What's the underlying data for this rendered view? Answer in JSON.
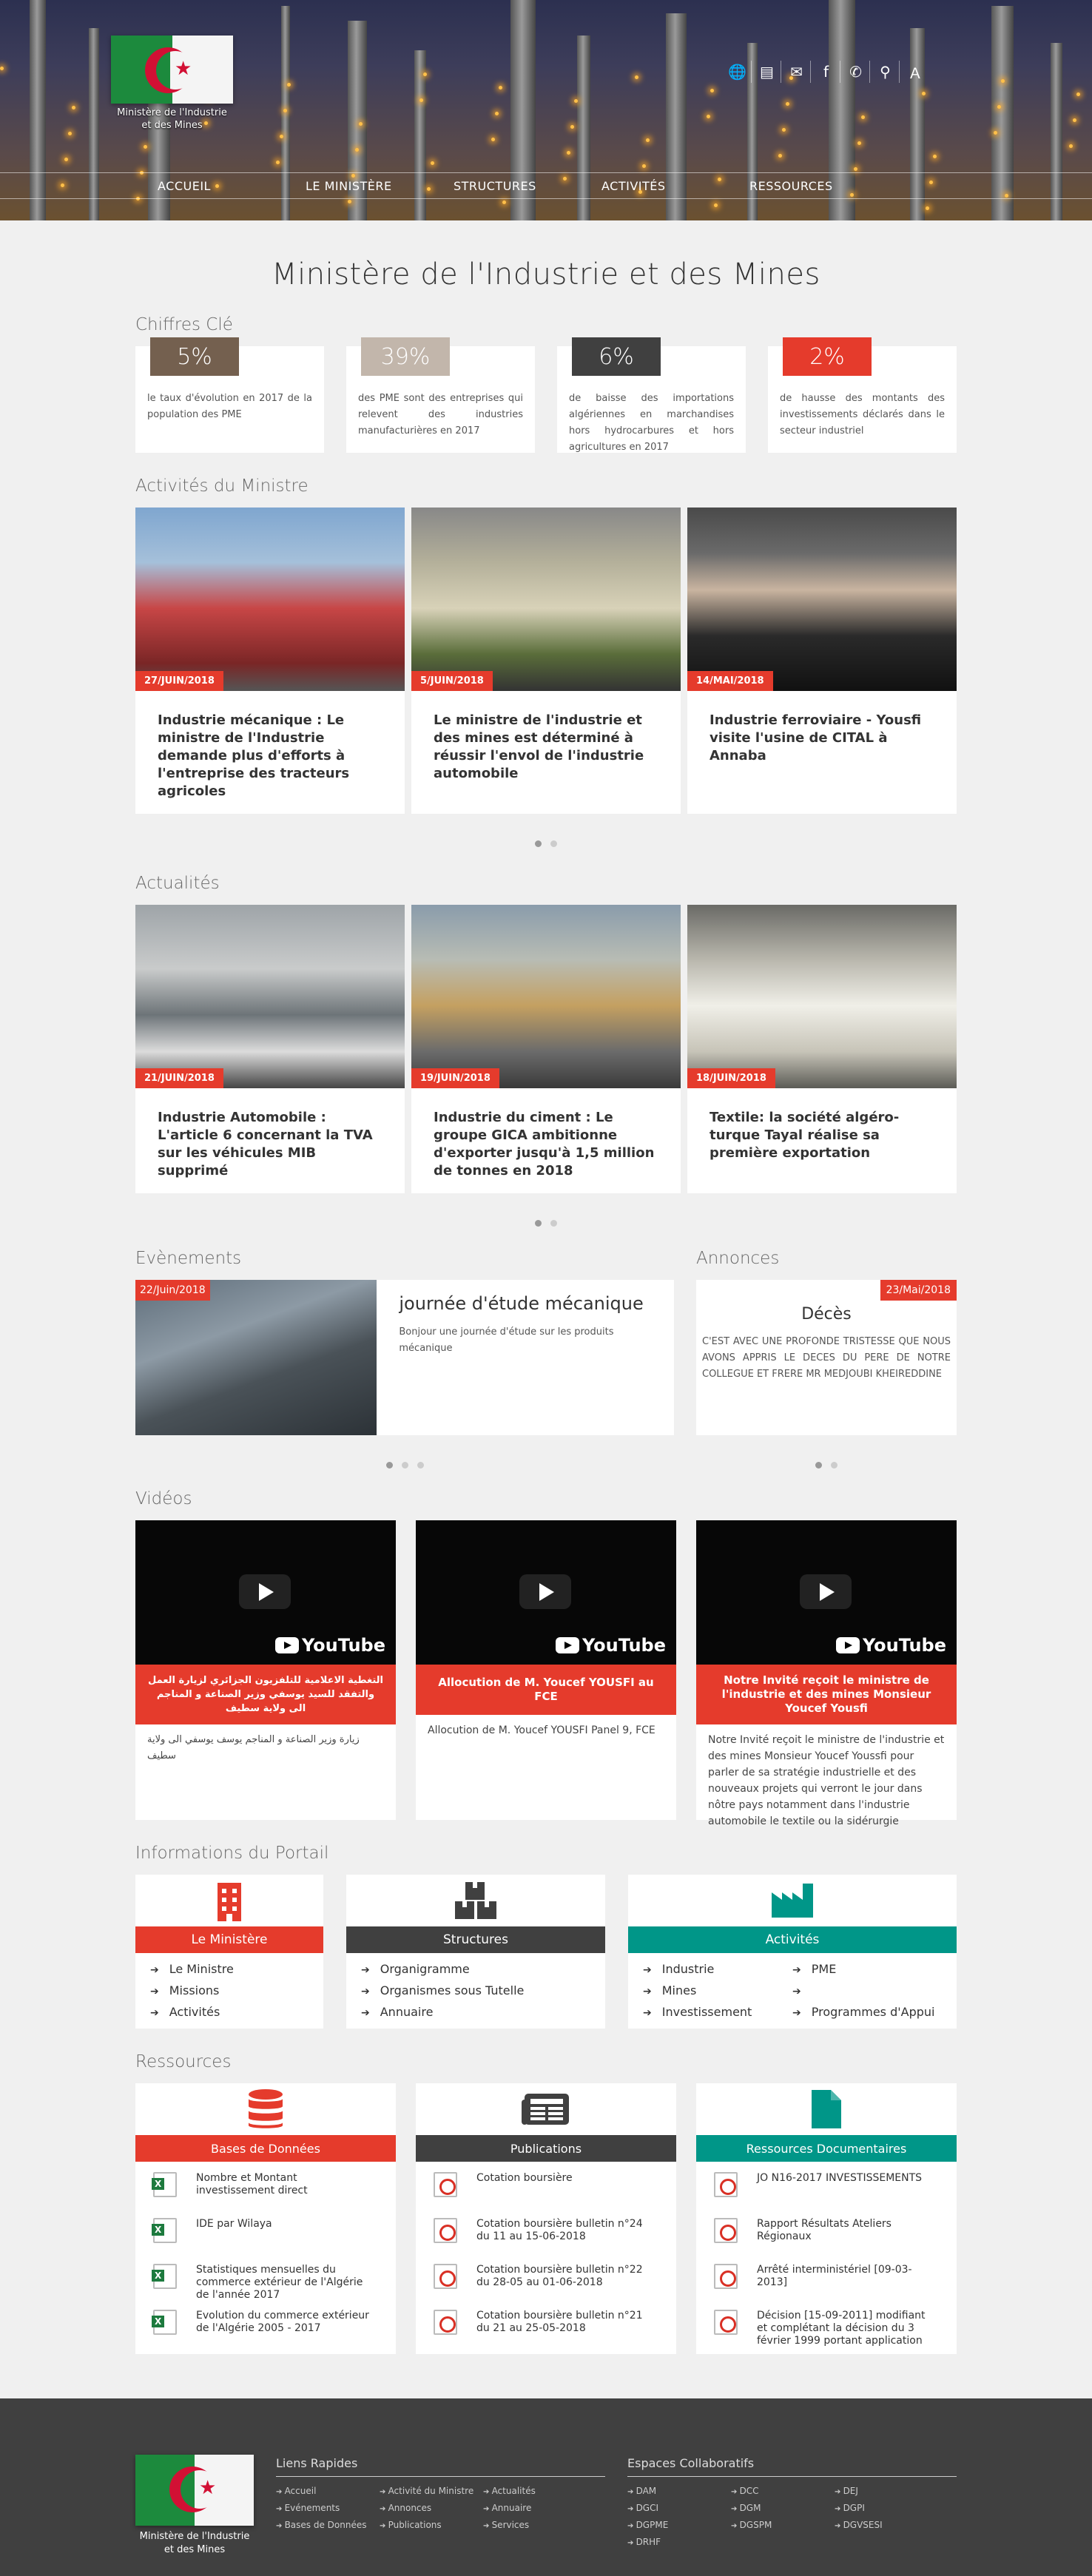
{
  "header": {
    "logo_text": "Ministère de l'Industrie et des Mines",
    "nav": [
      "ACCUEIL",
      "LE MINISTÈRE",
      "STRUCTURES",
      "ACTIVITÉS",
      "RESSOURCES"
    ]
  },
  "page_title": "Ministère de l'Industrie et des Mines",
  "chiffres": {
    "title": "Chiffres Clé",
    "items": [
      {
        "value": "5%",
        "text": "le taux d'évolution en 2017 de la population des PME",
        "color": "#74604f"
      },
      {
        "value": "39%",
        "text": "des PME sont des entreprises qui relevent des industries manufacturières en 2017",
        "color": "#c2b6ab"
      },
      {
        "value": "6%",
        "text": "de baisse des importations algériennes en marchandises hors hydrocarbures et hors agricultures en 2017",
        "color": "#404040"
      },
      {
        "value": "2%",
        "text": "de hausse des montants des investissements déclarés dans le secteur industriel",
        "color": "#e53b2c"
      }
    ]
  },
  "activites": {
    "title": "Activités du Ministre",
    "cards": [
      {
        "date": "27/JUIN/2018",
        "title": "Industrie mécanique : Le ministre de l'Industrie demande plus d'efforts à l'entreprise des tracteurs agricoles"
      },
      {
        "date": "5/JUIN/2018",
        "title": "Le ministre de l'industrie et des mines est déterminé à réussir l'envol de l'industrie automobile"
      },
      {
        "date": "14/MAI/2018",
        "title": "Industrie ferroviaire - Yousfi visite l'usine de CITAL à Annaba"
      }
    ]
  },
  "actualites": {
    "title": "Actualités",
    "cards": [
      {
        "date": "21/JUIN/2018",
        "title": "Industrie Automobile : L'article 6 concernant la TVA sur les véhicules MIB supprimé"
      },
      {
        "date": "19/JUIN/2018",
        "title": "Industrie du ciment : Le groupe GICA ambitionne d'exporter jusqu'à 1,5 million de tonnes en 2018"
      },
      {
        "date": "18/JUIN/2018",
        "title": "Textile: la société algéro-turque Tayal réalise sa première exportation"
      }
    ]
  },
  "evenements": {
    "title": "Evènements",
    "date": "22/Juin/2018",
    "heading": "journée d'étude mécanique",
    "text": "Bonjour une journée d'étude sur les produits mécanique"
  },
  "annonces": {
    "title": "Annonces",
    "date": "23/Mai/2018",
    "heading": "Décès",
    "text": "C'est avec une profonde tristesse que nous avons appris le deces du pere de notre collegue et frere Mr MEDJOUBI KHEIREDDINE"
  },
  "videos": {
    "title": "Vidéos",
    "brand": "YouTube",
    "items": [
      {
        "title": "التغطية الاعلامية للتلفزيون الجزائري لزيارة العمل والتفقد للسيد يوسفي وزير الصناعة و المناجم الى ولاية سطيف",
        "desc": "زيارة وزير الصناعة و المناجم يوسف يوسفي الى ولاية سطيف"
      },
      {
        "title": "Allocution de M. Youcef YOUSFI au FCE",
        "desc": "Allocution de M. Youcef YOUSFI Panel 9, FCE"
      },
      {
        "title": "Notre Invité reçoit le ministre de l'industrie et des mines Monsieur Youcef Yousfi",
        "desc": "Notre Invité reçoit le ministre de l'industrie et des mines Monsieur Youcef Youssfi pour parler de sa stratégie industrielle et des nouveaux projets qui verront le jour dans nôtre pays notamment dans l'industrie automobile le textile ou la sidérurgie"
      }
    ]
  },
  "informations": {
    "title": "Informations du Portail",
    "blocks": [
      {
        "label": "Le Ministère",
        "color": "#e53b2c",
        "icon_color": "#e53b2c",
        "links": [
          "Le Ministre",
          "Missions",
          "Activités"
        ]
      },
      {
        "label": "Structures",
        "color": "#404040",
        "icon_color": "#404040",
        "links": [
          "Organigramme",
          "Organismes sous Tutelle",
          "Annuaire"
        ]
      },
      {
        "label": "Activités",
        "color": "#009688",
        "icon_color": "#009688",
        "links": [
          "Industrie",
          "PME",
          "Mines",
          "",
          "Investissement",
          "Programmes d'Appui"
        ]
      }
    ]
  },
  "ressources": {
    "title": "Ressources",
    "blocks": [
      {
        "label": "Bases de Données",
        "color": "#e53b2c",
        "type": "xl",
        "items": [
          "Nombre et Montant investissement direct",
          "IDE par Wilaya",
          "Statistiques mensuelles du commerce extérieur de l'Algérie de l'année 2017",
          "Evolution du commerce extérieur de l'Algérie 2005 - 2017"
        ]
      },
      {
        "label": "Publications",
        "color": "#404040",
        "type": "pdf",
        "items": [
          "Cotation boursière",
          "Cotation boursière bulletin n°24 du 11 au 15-06-2018",
          "Cotation boursière bulletin n°22 du 28-05 au 01-06-2018",
          "Cotation boursière bulletin n°21 du 21 au 25-05-2018"
        ]
      },
      {
        "label": "Ressources Documentaires",
        "color": "#009688",
        "type": "pdf",
        "items": [
          "JO N16-2017 INVESTISSEMENTS",
          "Rapport Résultats Ateliers Régionaux",
          "Arrêté interministériel [09-03-2013]",
          "Décision [15-09-2011] modifiant et complétant la décision du 3 février 1999 portant application"
        ]
      }
    ]
  },
  "footer": {
    "logo_text": "Ministère de l'Industrie et des Mines",
    "liens_title": "Liens Rapides",
    "liens": [
      "Accueil",
      "Activité du Ministre",
      "Actualités",
      "Evénements",
      "Annonces",
      "Annuaire",
      "Bases de Données",
      "Publications",
      "Services"
    ],
    "espaces_title": "Espaces Collaboratifs",
    "espaces": [
      "DAM",
      "DCC",
      "DEJ",
      "DGCI",
      "DGM",
      "DGPI",
      "DGPME",
      "DGSPM",
      "DGVSESI",
      "DRHF"
    ]
  }
}
